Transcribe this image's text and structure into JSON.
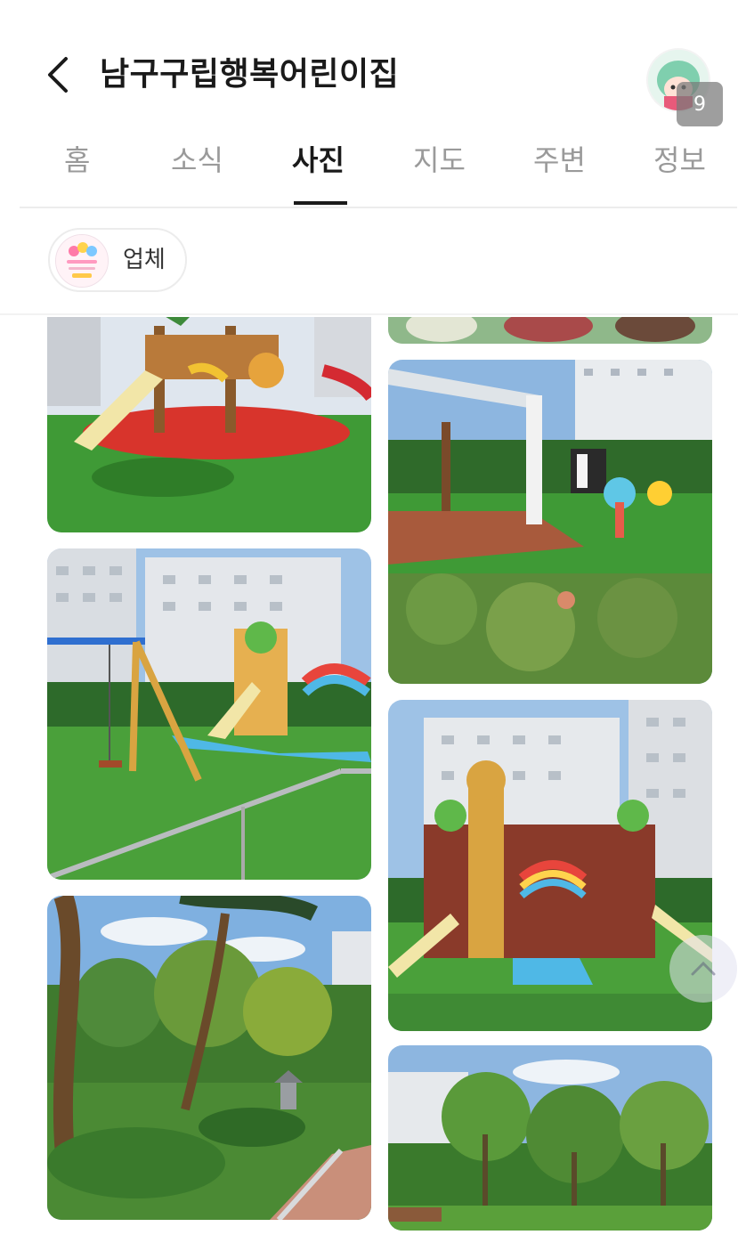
{
  "header": {
    "title": "남구구립행복어린이집",
    "back_icon": "chevron-left-icon",
    "photo_count": "9"
  },
  "tabs": [
    {
      "label": "홈",
      "active": false
    },
    {
      "label": "소식",
      "active": false
    },
    {
      "label": "사진",
      "active": true
    },
    {
      "label": "지도",
      "active": false
    },
    {
      "label": "주변",
      "active": false
    },
    {
      "label": "정보",
      "active": false
    }
  ],
  "filter": {
    "chip_label": "업체"
  },
  "photos": [
    {
      "subject": "playground-slide-lion"
    },
    {
      "subject": "people-partial"
    },
    {
      "subject": "pergola-zebra"
    },
    {
      "subject": "swings-playground"
    },
    {
      "subject": "giraffe-playground"
    },
    {
      "subject": "garden-trees"
    },
    {
      "subject": "park-trees"
    }
  ],
  "colors": {
    "accent": "#1a1a1a",
    "inactive_tab": "#9a9a9a",
    "divider": "#ececec",
    "turf": "#3f9a36",
    "sky": "#8db6e0"
  }
}
